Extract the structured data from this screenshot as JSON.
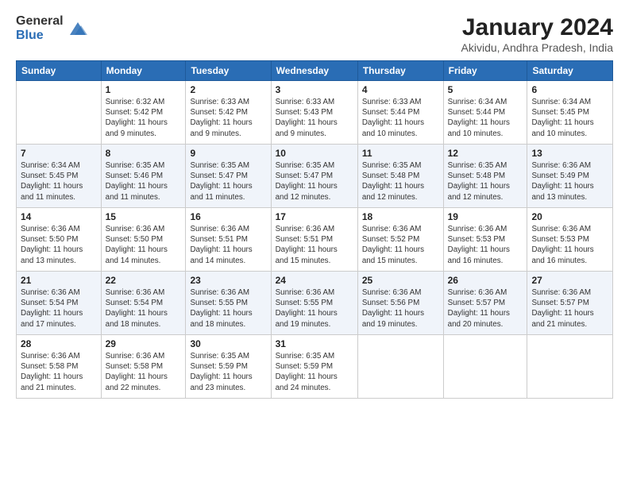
{
  "logo": {
    "general": "General",
    "blue": "Blue"
  },
  "title": {
    "month": "January 2024",
    "location": "Akividu, Andhra Pradesh, India"
  },
  "weekdays": [
    "Sunday",
    "Monday",
    "Tuesday",
    "Wednesday",
    "Thursday",
    "Friday",
    "Saturday"
  ],
  "weeks": [
    [
      {
        "day": "",
        "info": ""
      },
      {
        "day": "1",
        "info": "Sunrise: 6:32 AM\nSunset: 5:42 PM\nDaylight: 11 hours\nand 9 minutes."
      },
      {
        "day": "2",
        "info": "Sunrise: 6:33 AM\nSunset: 5:42 PM\nDaylight: 11 hours\nand 9 minutes."
      },
      {
        "day": "3",
        "info": "Sunrise: 6:33 AM\nSunset: 5:43 PM\nDaylight: 11 hours\nand 9 minutes."
      },
      {
        "day": "4",
        "info": "Sunrise: 6:33 AM\nSunset: 5:44 PM\nDaylight: 11 hours\nand 10 minutes."
      },
      {
        "day": "5",
        "info": "Sunrise: 6:34 AM\nSunset: 5:44 PM\nDaylight: 11 hours\nand 10 minutes."
      },
      {
        "day": "6",
        "info": "Sunrise: 6:34 AM\nSunset: 5:45 PM\nDaylight: 11 hours\nand 10 minutes."
      }
    ],
    [
      {
        "day": "7",
        "info": "Sunrise: 6:34 AM\nSunset: 5:45 PM\nDaylight: 11 hours\nand 11 minutes."
      },
      {
        "day": "8",
        "info": "Sunrise: 6:35 AM\nSunset: 5:46 PM\nDaylight: 11 hours\nand 11 minutes."
      },
      {
        "day": "9",
        "info": "Sunrise: 6:35 AM\nSunset: 5:47 PM\nDaylight: 11 hours\nand 11 minutes."
      },
      {
        "day": "10",
        "info": "Sunrise: 6:35 AM\nSunset: 5:47 PM\nDaylight: 11 hours\nand 12 minutes."
      },
      {
        "day": "11",
        "info": "Sunrise: 6:35 AM\nSunset: 5:48 PM\nDaylight: 11 hours\nand 12 minutes."
      },
      {
        "day": "12",
        "info": "Sunrise: 6:35 AM\nSunset: 5:48 PM\nDaylight: 11 hours\nand 12 minutes."
      },
      {
        "day": "13",
        "info": "Sunrise: 6:36 AM\nSunset: 5:49 PM\nDaylight: 11 hours\nand 13 minutes."
      }
    ],
    [
      {
        "day": "14",
        "info": "Sunrise: 6:36 AM\nSunset: 5:50 PM\nDaylight: 11 hours\nand 13 minutes."
      },
      {
        "day": "15",
        "info": "Sunrise: 6:36 AM\nSunset: 5:50 PM\nDaylight: 11 hours\nand 14 minutes."
      },
      {
        "day": "16",
        "info": "Sunrise: 6:36 AM\nSunset: 5:51 PM\nDaylight: 11 hours\nand 14 minutes."
      },
      {
        "day": "17",
        "info": "Sunrise: 6:36 AM\nSunset: 5:51 PM\nDaylight: 11 hours\nand 15 minutes."
      },
      {
        "day": "18",
        "info": "Sunrise: 6:36 AM\nSunset: 5:52 PM\nDaylight: 11 hours\nand 15 minutes."
      },
      {
        "day": "19",
        "info": "Sunrise: 6:36 AM\nSunset: 5:53 PM\nDaylight: 11 hours\nand 16 minutes."
      },
      {
        "day": "20",
        "info": "Sunrise: 6:36 AM\nSunset: 5:53 PM\nDaylight: 11 hours\nand 16 minutes."
      }
    ],
    [
      {
        "day": "21",
        "info": "Sunrise: 6:36 AM\nSunset: 5:54 PM\nDaylight: 11 hours\nand 17 minutes."
      },
      {
        "day": "22",
        "info": "Sunrise: 6:36 AM\nSunset: 5:54 PM\nDaylight: 11 hours\nand 18 minutes."
      },
      {
        "day": "23",
        "info": "Sunrise: 6:36 AM\nSunset: 5:55 PM\nDaylight: 11 hours\nand 18 minutes."
      },
      {
        "day": "24",
        "info": "Sunrise: 6:36 AM\nSunset: 5:55 PM\nDaylight: 11 hours\nand 19 minutes."
      },
      {
        "day": "25",
        "info": "Sunrise: 6:36 AM\nSunset: 5:56 PM\nDaylight: 11 hours\nand 19 minutes."
      },
      {
        "day": "26",
        "info": "Sunrise: 6:36 AM\nSunset: 5:57 PM\nDaylight: 11 hours\nand 20 minutes."
      },
      {
        "day": "27",
        "info": "Sunrise: 6:36 AM\nSunset: 5:57 PM\nDaylight: 11 hours\nand 21 minutes."
      }
    ],
    [
      {
        "day": "28",
        "info": "Sunrise: 6:36 AM\nSunset: 5:58 PM\nDaylight: 11 hours\nand 21 minutes."
      },
      {
        "day": "29",
        "info": "Sunrise: 6:36 AM\nSunset: 5:58 PM\nDaylight: 11 hours\nand 22 minutes."
      },
      {
        "day": "30",
        "info": "Sunrise: 6:35 AM\nSunset: 5:59 PM\nDaylight: 11 hours\nand 23 minutes."
      },
      {
        "day": "31",
        "info": "Sunrise: 6:35 AM\nSunset: 5:59 PM\nDaylight: 11 hours\nand 24 minutes."
      },
      {
        "day": "",
        "info": ""
      },
      {
        "day": "",
        "info": ""
      },
      {
        "day": "",
        "info": ""
      }
    ]
  ]
}
